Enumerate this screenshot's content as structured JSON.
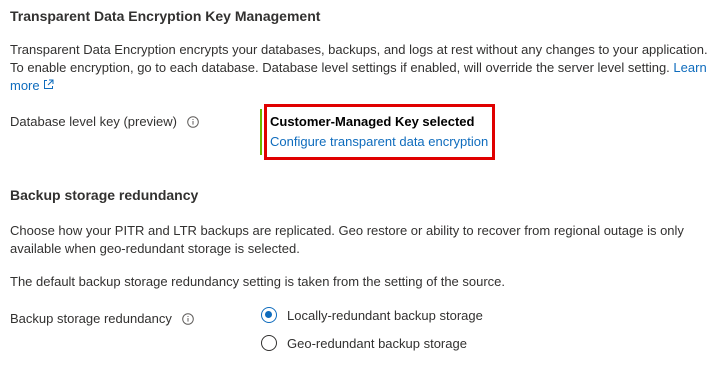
{
  "tde": {
    "title": "Transparent Data Encryption Key Management",
    "desc_line1": "Transparent Data Encryption encrypts your databases, backups, and logs at rest without any changes to your application.",
    "desc_line2": "To enable encryption, go to each database. Database level settings if enabled, will override the server level setting.",
    "learn_more_part1": "Learn",
    "learn_more_part2": "more",
    "db_key_label": "Database level key (preview)",
    "cmk_title": "Customer-Managed Key selected",
    "cmk_link": "Configure transparent data encryption"
  },
  "backup": {
    "title": "Backup storage redundancy",
    "desc_line1": "Choose how your PITR and LTR backups are replicated. Geo restore or ability to recover from regional outage is only",
    "desc_line2": "available when geo-redundant storage is selected.",
    "default_note": "The default backup storage redundancy setting is taken from the setting of the source.",
    "field_label": "Backup storage redundancy",
    "options": [
      {
        "label": "Locally-redundant backup storage",
        "selected": true
      },
      {
        "label": "Geo-redundant backup storage",
        "selected": false
      }
    ]
  },
  "colors": {
    "link": "#0f6cbd",
    "highlight_border": "#e00000",
    "status_bar": "#6bb700"
  }
}
